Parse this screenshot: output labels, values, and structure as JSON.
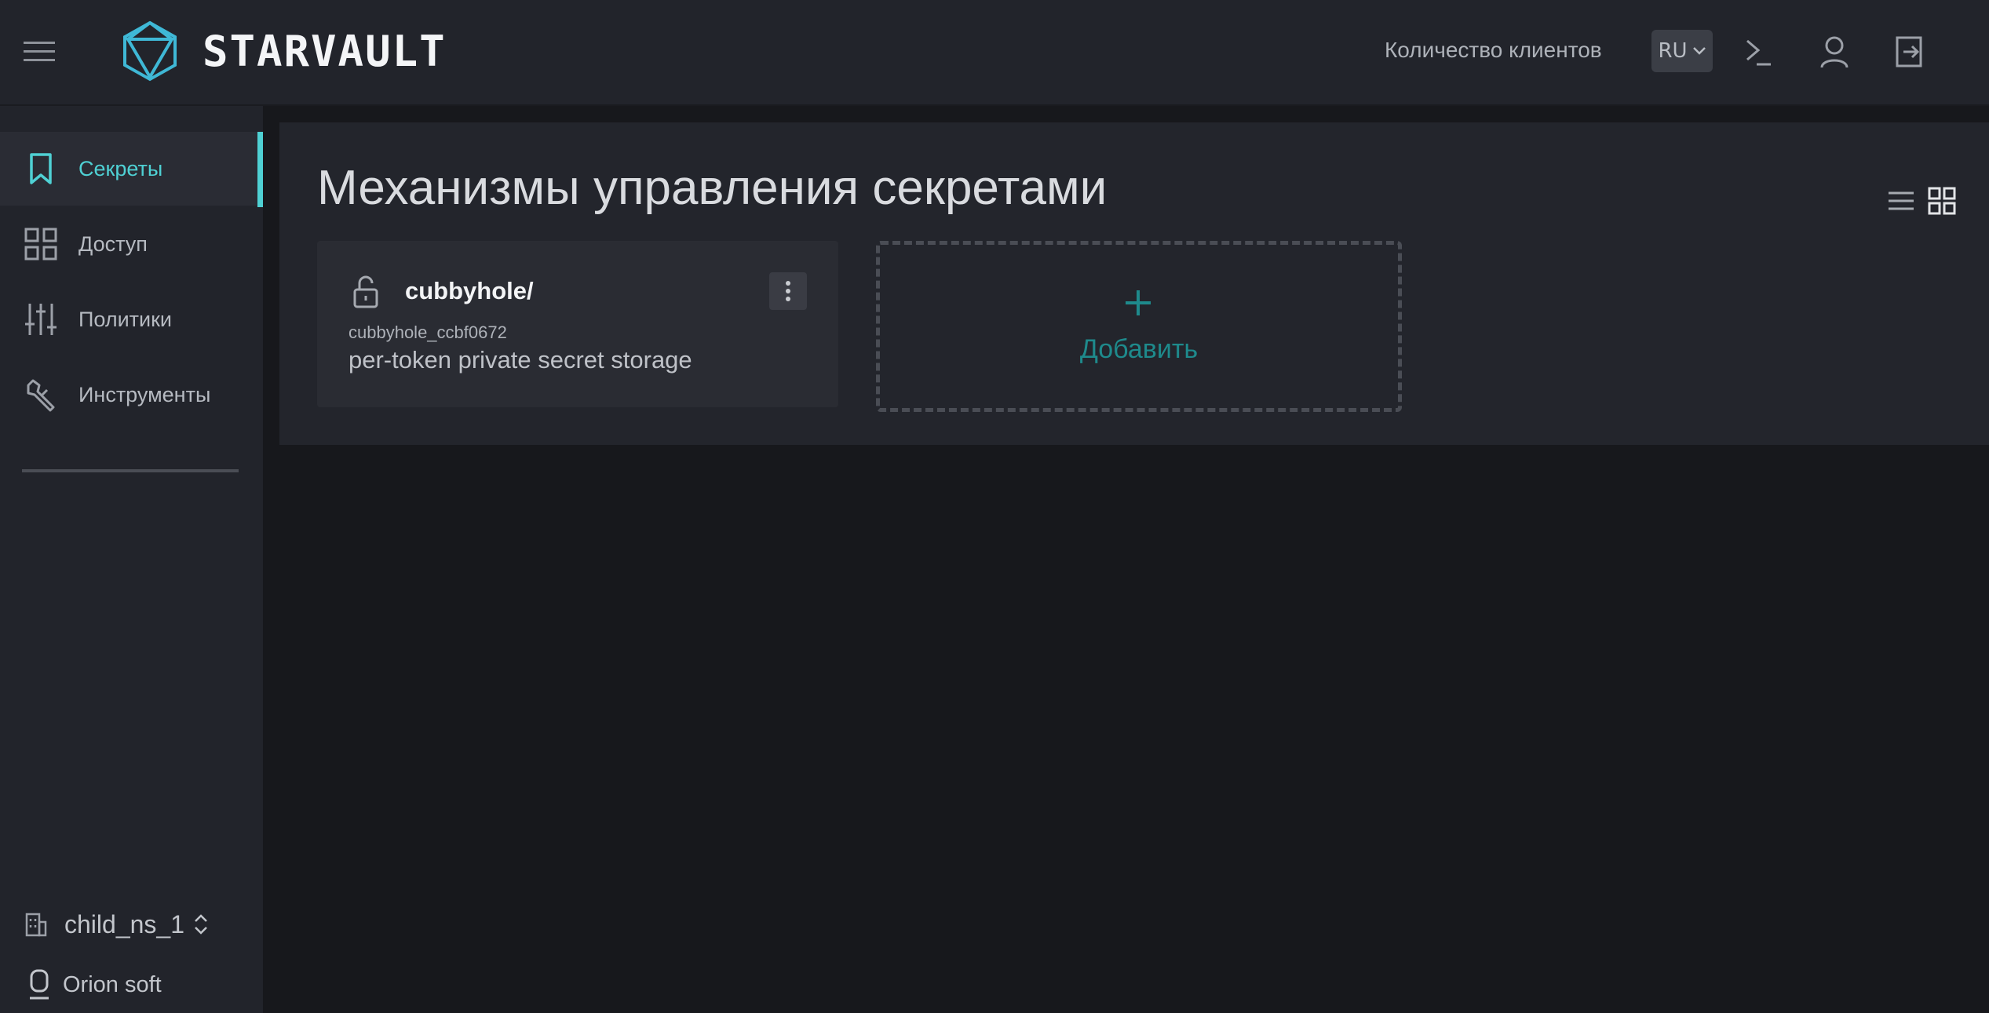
{
  "header": {
    "logo_text": "STARVAULT",
    "client_count_link": "Количество клиентов",
    "language": "RU"
  },
  "sidebar": {
    "items": [
      {
        "label": "Секреты",
        "icon": "bookmark-icon",
        "active": true
      },
      {
        "label": "Доступ",
        "icon": "grid-icon",
        "active": false
      },
      {
        "label": "Политики",
        "icon": "sliders-icon",
        "active": false
      },
      {
        "label": "Инструменты",
        "icon": "wrench-icon",
        "active": false
      }
    ],
    "namespace": "child_ns_1",
    "organization": "Orion soft"
  },
  "main": {
    "title": "Механизмы управления секретами",
    "cards": [
      {
        "title": "cubbyhole/",
        "accessor": "cubbyhole_ccbf0672",
        "description": "per-token private secret storage"
      }
    ],
    "add_label": "Добавить"
  },
  "colors": {
    "accent": "#4fd1d4",
    "add_accent": "#1e8a8c",
    "header_bg": "#22242b",
    "page_bg": "#17181c"
  }
}
